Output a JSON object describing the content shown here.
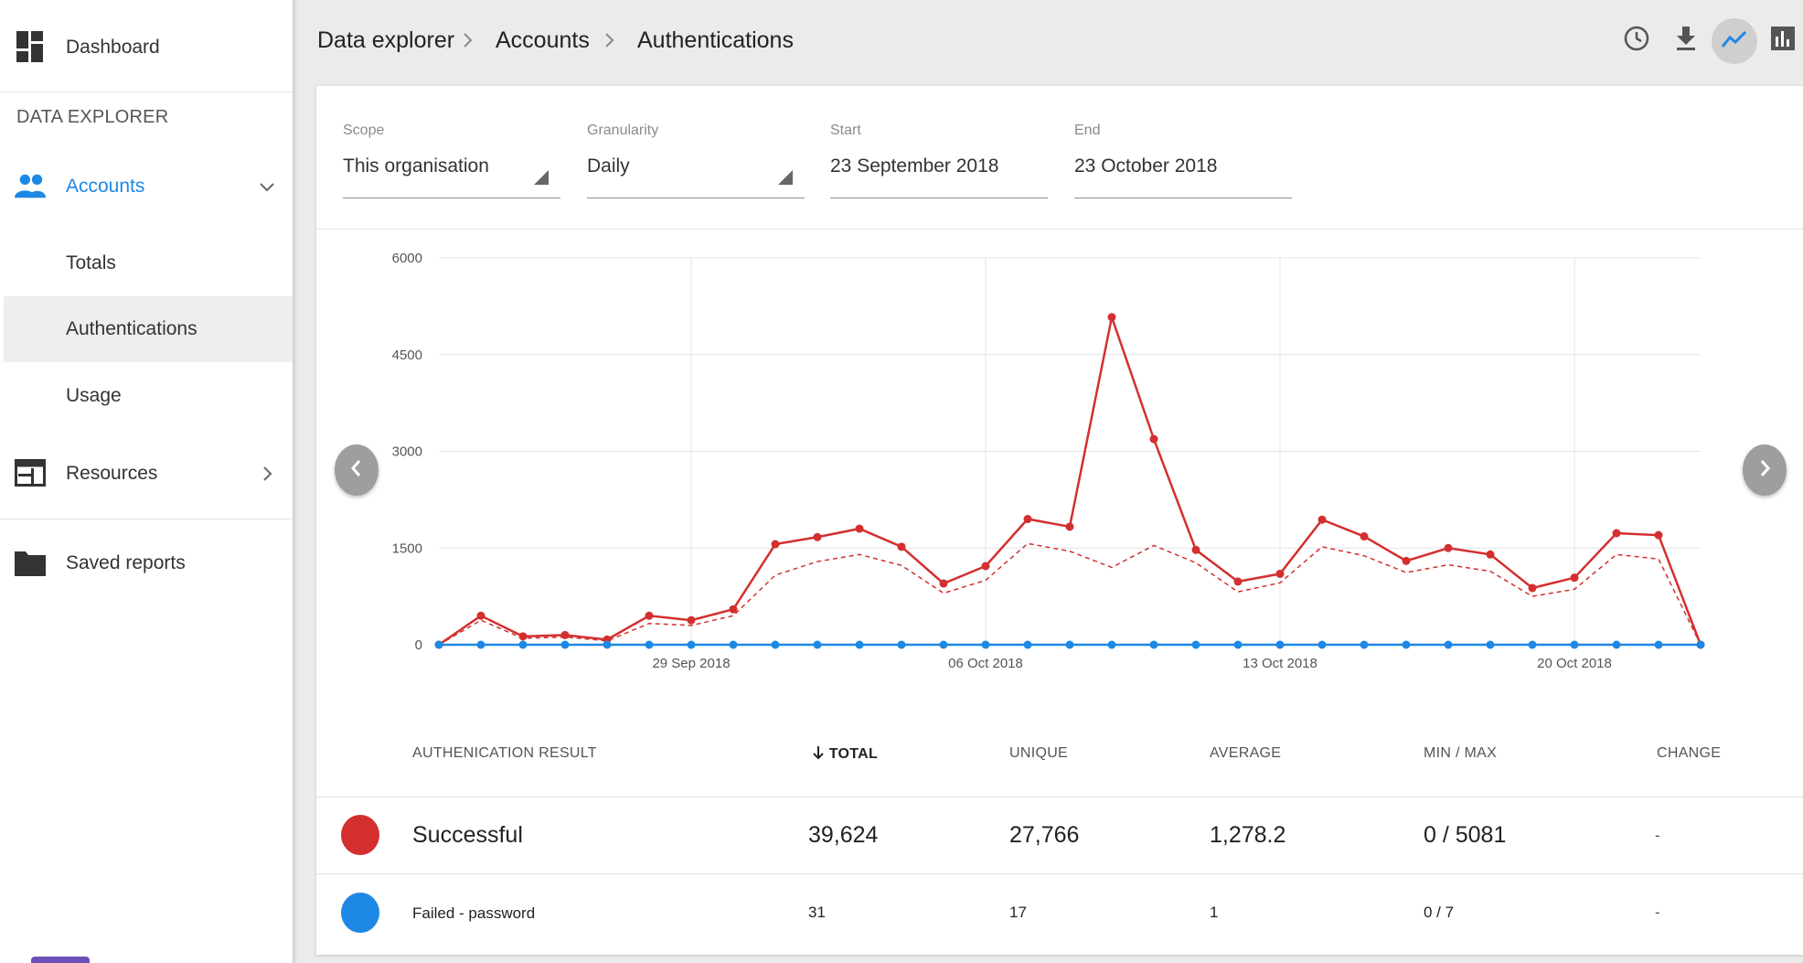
{
  "sidebar": {
    "dashboard_label": "Dashboard",
    "section_title": "DATA EXPLORER",
    "accounts_label": "Accounts",
    "accounts_items": [
      "Totals",
      "Authentications",
      "Usage"
    ],
    "resources_label": "Resources",
    "saved_reports_label": "Saved reports",
    "accent_color": "#1e88e5"
  },
  "breadcrumb": [
    "Data explorer",
    "Accounts",
    "Authentications"
  ],
  "toolbar": {
    "icons": [
      "history-icon",
      "download-icon",
      "line-chart-icon",
      "bar-chart-icon"
    ],
    "active": "line-chart-icon"
  },
  "filters": {
    "scope": {
      "label": "Scope",
      "value": "This organisation"
    },
    "granularity": {
      "label": "Granularity",
      "value": "Daily"
    },
    "start": {
      "label": "Start",
      "value": "23 September 2018"
    },
    "end": {
      "label": "End",
      "value": "23 October 2018"
    }
  },
  "chart_data": {
    "type": "line",
    "y_ticks": [
      "6000",
      "4500",
      "3000",
      "1500",
      "0"
    ],
    "ylim": [
      0,
      6000
    ],
    "x_tick_labels": [
      {
        "label": "29 Sep 2018",
        "index": 6
      },
      {
        "label": "06 Oct 2018",
        "index": 13
      },
      {
        "label": "13 Oct 2018",
        "index": 20
      },
      {
        "label": "20 Oct 2018",
        "index": 27
      }
    ],
    "grid": true,
    "series": [
      {
        "color": "#d32f2f",
        "values": [
          0,
          450,
          130,
          150,
          80,
          450,
          380,
          550,
          1560,
          1670,
          1800,
          1520,
          950,
          1220,
          1950,
          1830,
          5081,
          3190,
          1470,
          980,
          1100,
          1940,
          1680,
          1300,
          1500,
          1400,
          880,
          1040,
          1730,
          1700,
          0
        ]
      },
      {
        "color": "#d32f2f",
        "dashed": true,
        "values": [
          0,
          380,
          100,
          120,
          60,
          330,
          300,
          450,
          1080,
          1290,
          1400,
          1230,
          800,
          1000,
          1570,
          1450,
          1200,
          1540,
          1270,
          820,
          960,
          1520,
          1380,
          1120,
          1240,
          1140,
          750,
          860,
          1400,
          1330,
          0
        ]
      },
      {
        "color": "#1e88e5",
        "values": [
          0,
          0,
          0,
          0,
          0,
          0,
          0,
          0,
          0,
          0,
          0,
          0,
          0,
          0,
          0,
          0,
          0,
          0,
          0,
          0,
          0,
          0,
          0,
          0,
          0,
          0,
          0,
          0,
          0,
          0,
          0
        ]
      }
    ]
  },
  "table": {
    "headers": {
      "result": "AUTHENICATION RESULT",
      "total": "TOTAL",
      "unique": "UNIQUE",
      "average": "AVERAGE",
      "minmax": "MIN / MAX",
      "change": "CHANGE"
    },
    "rows": [
      {
        "color": "#d32f2f",
        "name": "Successful",
        "total": "39,624",
        "unique": "27,766",
        "average": "1,278.2",
        "minmax": "0 / 5081",
        "change": "-"
      },
      {
        "color": "#1e88e5",
        "name": "Failed - password",
        "total": "31",
        "unique": "17",
        "average": "1",
        "minmax": "0 / 7",
        "change": "-"
      }
    ]
  }
}
